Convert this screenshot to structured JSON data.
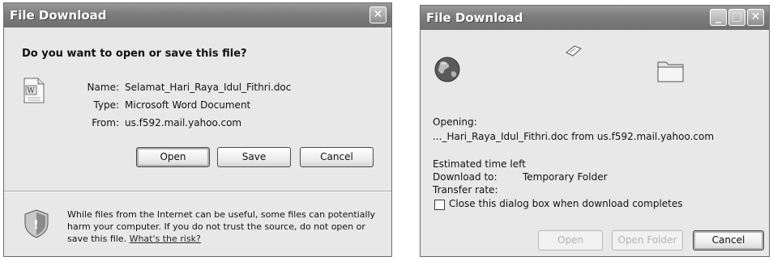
{
  "dialog_left": {
    "title": "File Download",
    "question": "Do you want to open or save this file?",
    "fields": {
      "name_label": "Name:",
      "name_value": "Selamat_Hari_Raya_Idul_Fithri.doc",
      "type_label": "Type:",
      "type_value": "Microsoft Word Document",
      "from_label": "From:",
      "from_value": "us.f592.mail.yahoo.com"
    },
    "buttons": {
      "open": "Open",
      "save": "Save",
      "cancel": "Cancel"
    },
    "warning_line1": "While files from the Internet can be useful, some files can potentially",
    "warning_line2": "harm your computer. If you do not trust the source, do not open or",
    "warning_line3_prefix": "save this file.",
    "warning_link": "What's the risk?",
    "icons": {
      "file": "word-document-icon",
      "close": "close-icon",
      "shield": "shield-icon"
    }
  },
  "dialog_right": {
    "title": "File Download",
    "opening_label": "Opening:",
    "opening_value": "..._Hari_Raya_Idul_Fithri.doc from us.f592.mail.yahoo.com",
    "time_left_label": "Estimated time left",
    "download_to_label": "Download to:",
    "download_to_value": "Temporary Folder",
    "transfer_rate_label": "Transfer rate:",
    "close_checkbox_label": "Close this dialog box when download completes",
    "close_checkbox_checked": false,
    "buttons": {
      "open": "Open",
      "open_folder": "Open Folder",
      "cancel": "Cancel"
    },
    "icons": {
      "source": "globe-icon",
      "transfer": "flying-paper-icon",
      "destination": "folder-icon"
    }
  }
}
